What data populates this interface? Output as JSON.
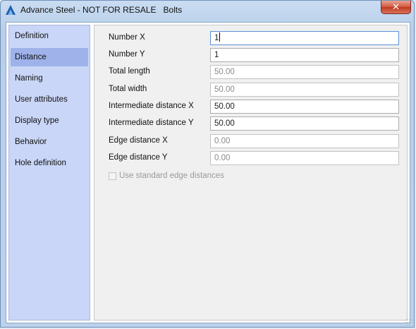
{
  "window": {
    "title": "Advance Steel - NOT FOR RESALE   Bolts",
    "close_label": "✕"
  },
  "sidebar": {
    "items": [
      {
        "label": "Definition"
      },
      {
        "label": "Distance"
      },
      {
        "label": "Naming"
      },
      {
        "label": "User attributes"
      },
      {
        "label": "Display type"
      },
      {
        "label": "Behavior"
      },
      {
        "label": "Hole definition"
      }
    ],
    "selected": "Distance"
  },
  "form": {
    "number_x": {
      "label": "Number  X",
      "value": "1"
    },
    "number_y": {
      "label": "Number  Y",
      "value": "1"
    },
    "total_length": {
      "label": "Total length",
      "value": "50.00"
    },
    "total_width": {
      "label": "Total width",
      "value": "50.00"
    },
    "intermediate_x": {
      "label": "Intermediate distance X",
      "value": "50.00"
    },
    "intermediate_y": {
      "label": "Intermediate distance Y",
      "value": "50.00"
    },
    "edge_x": {
      "label": "Edge distance X",
      "value": "0.00"
    },
    "edge_y": {
      "label": "Edge distance Y",
      "value": "0.00"
    },
    "use_standard": {
      "label": "Use standard edge distances",
      "checked": false
    }
  },
  "colors": {
    "accent": "#9fb3ea",
    "sidebar_bg": "#c9d6f7",
    "close_button": "#c8462a"
  }
}
